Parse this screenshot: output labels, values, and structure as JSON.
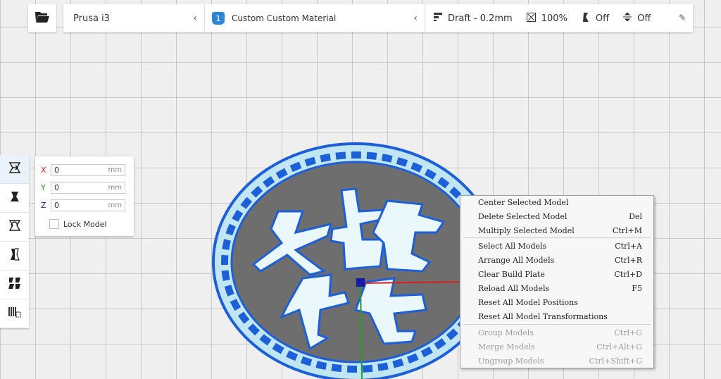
{
  "topbar": {
    "printer": "Prusa i3",
    "material_badge": "1",
    "material": "Custom Custom Material",
    "profile": "Draft - 0.2mm",
    "infill": "100%",
    "support": "Off",
    "adhesion": "Off"
  },
  "move_panel": {
    "x_label": "X",
    "y_label": "Y",
    "z_label": "Z",
    "x_value": "0",
    "y_value": "0",
    "z_value": "0",
    "unit": "mm",
    "lock_label": "Lock Model"
  },
  "context_menu": {
    "group1": [
      {
        "label": "Center Selected Model",
        "shortcut": ""
      },
      {
        "label": "Delete Selected Model",
        "shortcut": "Del"
      },
      {
        "label": "Multiply Selected Model",
        "shortcut": "Ctrl+M"
      }
    ],
    "group2": [
      {
        "label": "Select All Models",
        "shortcut": "Ctrl+A"
      },
      {
        "label": "Arrange All Models",
        "shortcut": "Ctrl+R"
      },
      {
        "label": "Clear Build Plate",
        "shortcut": "Ctrl+D"
      },
      {
        "label": "Reload All Models",
        "shortcut": "F5"
      },
      {
        "label": "Reset All Model Positions",
        "shortcut": ""
      },
      {
        "label": "Reset All Model Transformations",
        "shortcut": ""
      }
    ],
    "group3": [
      {
        "label": "Group Models",
        "shortcut": "Ctrl+G",
        "disabled": true
      },
      {
        "label": "Merge Models",
        "shortcut": "Ctrl+Alt+G",
        "disabled": true
      },
      {
        "label": "Ungroup Models",
        "shortcut": "Ctrl+Shift+G",
        "disabled": true
      }
    ]
  },
  "model": {
    "characters": "娴祥"
  },
  "colors": {
    "accent": "#2e87d6",
    "model_face": "#6f6f6f",
    "model_outline": "#1d5fd6",
    "model_highlight": "#e8f6fb",
    "axis_x": "#d62020",
    "axis_y": "#20a020",
    "axis_z": "#1a1aa8"
  }
}
